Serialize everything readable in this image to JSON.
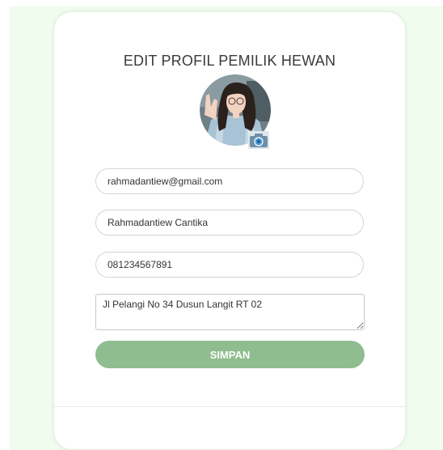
{
  "page": {
    "background_color": "#effcee",
    "card_color": "#ffffff"
  },
  "form": {
    "title": "EDIT PROFIL PEMILIK HEWAN",
    "avatar_icon": "profile-photo",
    "camera_icon": "camera-icon",
    "email": "rahmadantiew@gmail.com",
    "name": "Rahmadantiew Cantika",
    "phone": "081234567891",
    "address": "Jl Pelangi No 34 Dusun Langit RT 02",
    "submit_label": "SIMPAN",
    "submit_color": "#8fbd8f"
  }
}
